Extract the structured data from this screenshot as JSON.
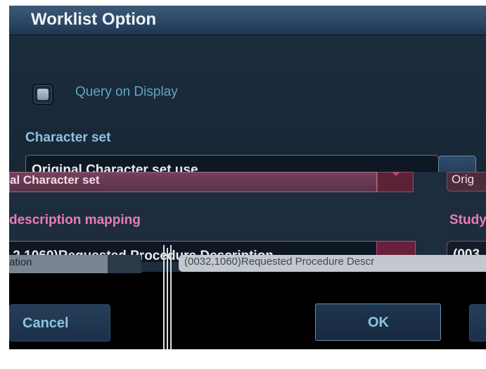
{
  "dialog": {
    "title": "Worklist Option"
  },
  "query_on_display": {
    "label": "Query on Display",
    "checked": false
  },
  "character_set": {
    "label": "Character set",
    "value": "Original Character set use",
    "value_duplicate": "al Character set"
  },
  "organization_field": {
    "value": "Orig"
  },
  "description_mapping": {
    "label": "description mapping",
    "value": ",2,1060)Requested Procedure Description",
    "study_label": "Study",
    "study_value": "(003"
  },
  "glitch": {
    "left_text": "ation",
    "right_text": "(0032,1060)Requested Procedure Descr"
  },
  "buttons": {
    "cancel": "Cancel",
    "ok": "OK"
  },
  "colors": {
    "titlebar": "#2b4663",
    "panel": "#182736",
    "label_blue": "#8fc2e0",
    "label_pink": "#e97cb9",
    "button_text": "#8ec4e4"
  }
}
